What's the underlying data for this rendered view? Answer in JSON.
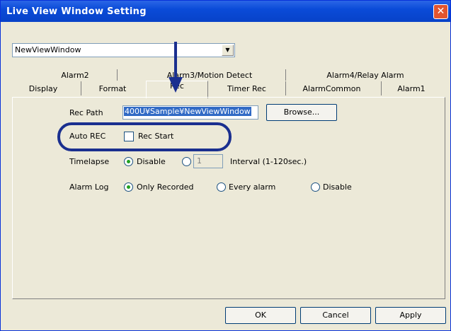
{
  "window": {
    "title": "Live View Window Setting"
  },
  "combo": {
    "value": "NewViewWindow"
  },
  "tabs_back": [
    "Alarm2",
    "Alarm3/Motion Detect",
    "Alarm4/Relay Alarm"
  ],
  "tabs_front": [
    "Display",
    "Format",
    "Rec",
    "Timer Rec",
    "AlarmCommon",
    "Alarm1"
  ],
  "rec": {
    "path_label": "Rec Path",
    "path_value": "400U¥Sample¥NewViewWindow",
    "browse_label": "Browse...",
    "autorec_label": "Auto REC",
    "autorec_check_label": "Rec Start",
    "timelapse_label": "Timelapse",
    "timelapse_disable": "Disable",
    "timelapse_value": "1",
    "interval_label": "Interval (1-120sec.)",
    "alarmlog_label": "Alarm Log",
    "alarmlog_only": "Only Recorded",
    "alarmlog_every": "Every alarm",
    "alarmlog_disable": "Disable"
  },
  "buttons": {
    "ok": "OK",
    "cancel": "Cancel",
    "apply": "Apply"
  }
}
